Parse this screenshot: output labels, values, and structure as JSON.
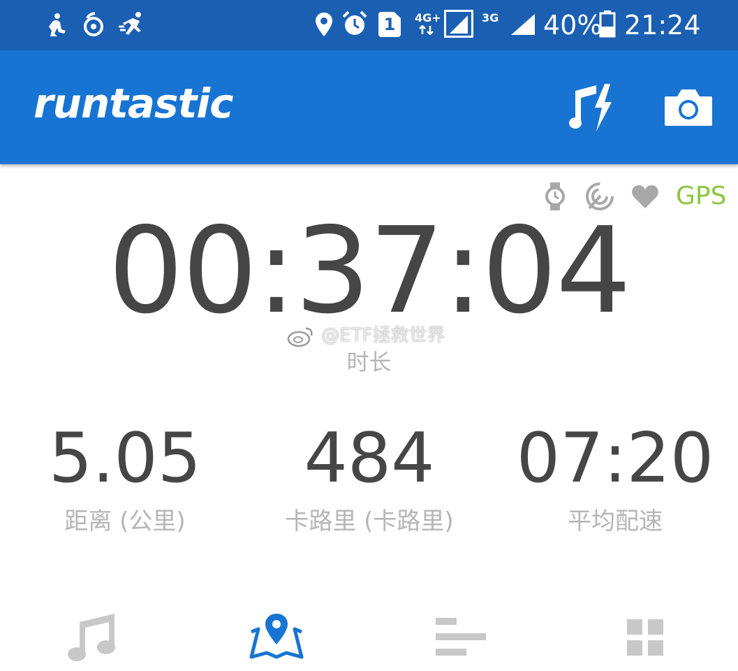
{
  "status_bar": {
    "network_4g": "4G+",
    "network_3g": "3G",
    "sim_slot": "1",
    "battery": "40%",
    "time": "21:24"
  },
  "app_bar": {
    "logo": "runtastic",
    "icons": [
      "music-power-icon",
      "camera-icon"
    ]
  },
  "sensors": {
    "icons": [
      "watch-icon",
      "live-tracking-icon",
      "heart-icon"
    ],
    "gps_label": "GPS",
    "gps_color": "#8cc63f"
  },
  "session": {
    "duration": "00:37:04",
    "duration_label": "时长",
    "watermark": "@ETF拯救世界"
  },
  "stats": [
    {
      "value": "5.05",
      "label": "距离 (公里)"
    },
    {
      "value": "484",
      "label": "卡路里 (卡路里)"
    },
    {
      "value": "07:20",
      "label": "平均配速"
    }
  ],
  "bottom_nav": {
    "items": [
      "music-icon",
      "map-icon",
      "stats-icon",
      "grid-icon"
    ],
    "active": "map-icon",
    "active_color": "#1874d2",
    "inactive_color": "#c8c8c8"
  },
  "colors": {
    "status_bar": "#1b5fb2",
    "app_bar": "#1874d2",
    "primary_text": "#464646",
    "secondary_text": "#b5b5b5"
  }
}
